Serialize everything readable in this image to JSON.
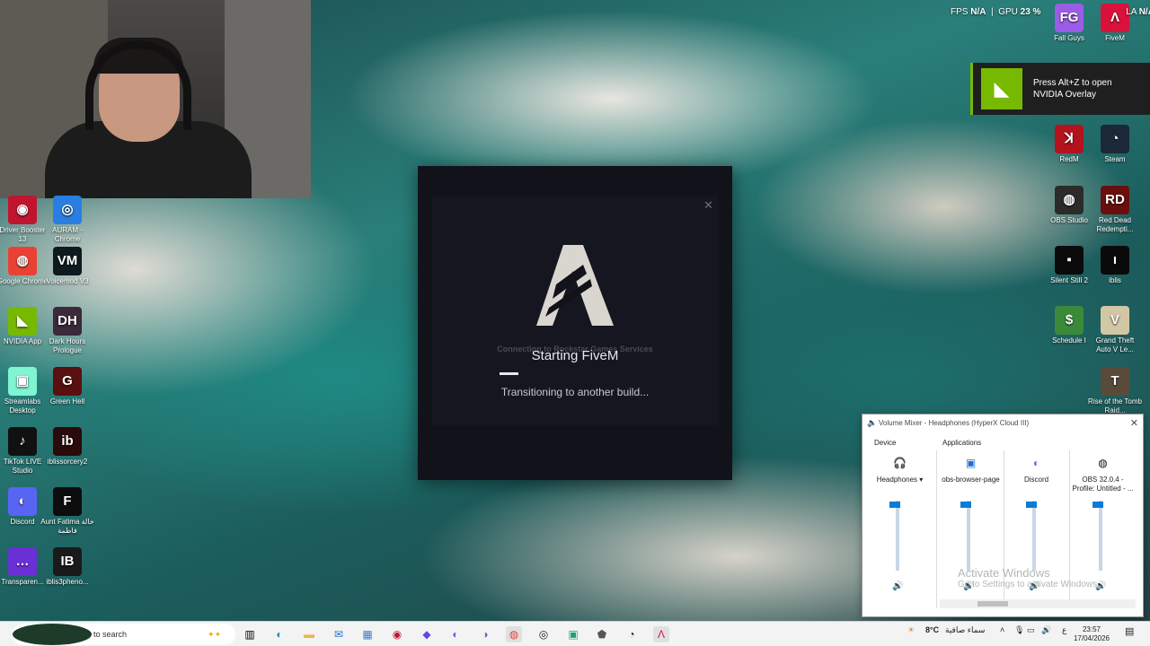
{
  "overlay": {
    "fps_label": "FPS",
    "fps_value": "N/A",
    "gpu_label": "GPU",
    "gpu_value": "23 %",
    "lat_label": "LA",
    "lat_value": "N/A",
    "nvidia_toast": "Press Alt+Z to open NVIDIA Overlay"
  },
  "desktop_left": [
    {
      "label": "Driver Booster 13",
      "color": "#c0152f",
      "glyph": "◉"
    },
    {
      "label": "AURAM - Chrome",
      "color": "#2a7de1",
      "glyph": "◎"
    },
    {
      "label": "Google Chrome",
      "color": "#e94235",
      "glyph": "◍"
    },
    {
      "label": "Voicemod V3",
      "color": "#0f1a1f",
      "glyph": "VM"
    },
    {
      "label": "NVIDIA App",
      "color": "#76b900",
      "glyph": "◣"
    },
    {
      "label": "Dark Hours Prologue",
      "color": "#3a2a3a",
      "glyph": "DH"
    },
    {
      "label": "Streamlabs Desktop",
      "color": "#80f5d2",
      "glyph": "▣"
    },
    {
      "label": "Green Hell",
      "color": "#5a1010",
      "glyph": "G"
    },
    {
      "label": "TikTok LIVE Studio",
      "color": "#111111",
      "glyph": "♪"
    },
    {
      "label": "iblissorcery2",
      "color": "#2a0a0a",
      "glyph": "ib"
    },
    {
      "label": "Discord",
      "color": "#5865f2",
      "glyph": "◐"
    },
    {
      "label": "Aunt Fatima خالة فاطمة",
      "color": "#0d0d0d",
      "glyph": "F"
    },
    {
      "label": "Transparen...",
      "color": "#6b2fd6",
      "glyph": "…"
    },
    {
      "label": "iblis3pheno...",
      "color": "#1a1a1a",
      "glyph": "IB"
    }
  ],
  "desktop_right": [
    {
      "label": "Fall Guys",
      "color": "#9b5de5",
      "glyph": "FG"
    },
    {
      "label": "FiveM",
      "color": "#d9123b",
      "glyph": "Λ"
    },
    {
      "label": "RedM",
      "color": "#b3121e",
      "glyph": "ꓘ"
    },
    {
      "label": "Steam",
      "color": "#1b2838",
      "glyph": "◔"
    },
    {
      "label": "OBS Studio",
      "color": "#2b2b2b",
      "glyph": "◍"
    },
    {
      "label": "Red Dead Redempti...",
      "color": "#6a0e0e",
      "glyph": "RD"
    },
    {
      "label": "Silent Still 2",
      "color": "#0b0b0b",
      "glyph": "▪"
    },
    {
      "label": "iblis",
      "color": "#0a0a0a",
      "glyph": "ı"
    },
    {
      "label": "Schedule I",
      "color": "#3a8a3a",
      "glyph": "$"
    },
    {
      "label": "Grand Theft Auto V Le...",
      "color": "#d2c7a4",
      "glyph": "V"
    },
    {
      "label": "Rise of the Tomb Raid...",
      "color": "#5a4a3a",
      "glyph": "T"
    }
  ],
  "fivem": {
    "ghost_text": "Connecting to Rockstar Games Services",
    "title": "Starting FiveM",
    "status": "Transitioning to another build..."
  },
  "mixer": {
    "title": "Volume Mixer - Headphones (HyperX Cloud III)",
    "device_label": "Device",
    "apps_label": "Applications",
    "columns": [
      {
        "name": "Headphones ▾",
        "glyph": "🎧",
        "level": 0.95
      },
      {
        "name": "obs-browser-page",
        "glyph": "▣",
        "level": 0.95
      },
      {
        "name": "Discord",
        "glyph": "◐",
        "level": 0.95
      },
      {
        "name": "OBS 32.0.4 - Profile: Untitled - ...",
        "glyph": "◍",
        "level": 0.95
      }
    ]
  },
  "watermark": {
    "title": "Activate Windows",
    "subtitle": "Go to Settings to activate Windows."
  },
  "taskbar": {
    "search_placeholder": "to search",
    "weather": "8°C",
    "weather_desc": "سماء صافية",
    "lang": "ع",
    "time": "23:57",
    "date": "17/04/2026"
  }
}
